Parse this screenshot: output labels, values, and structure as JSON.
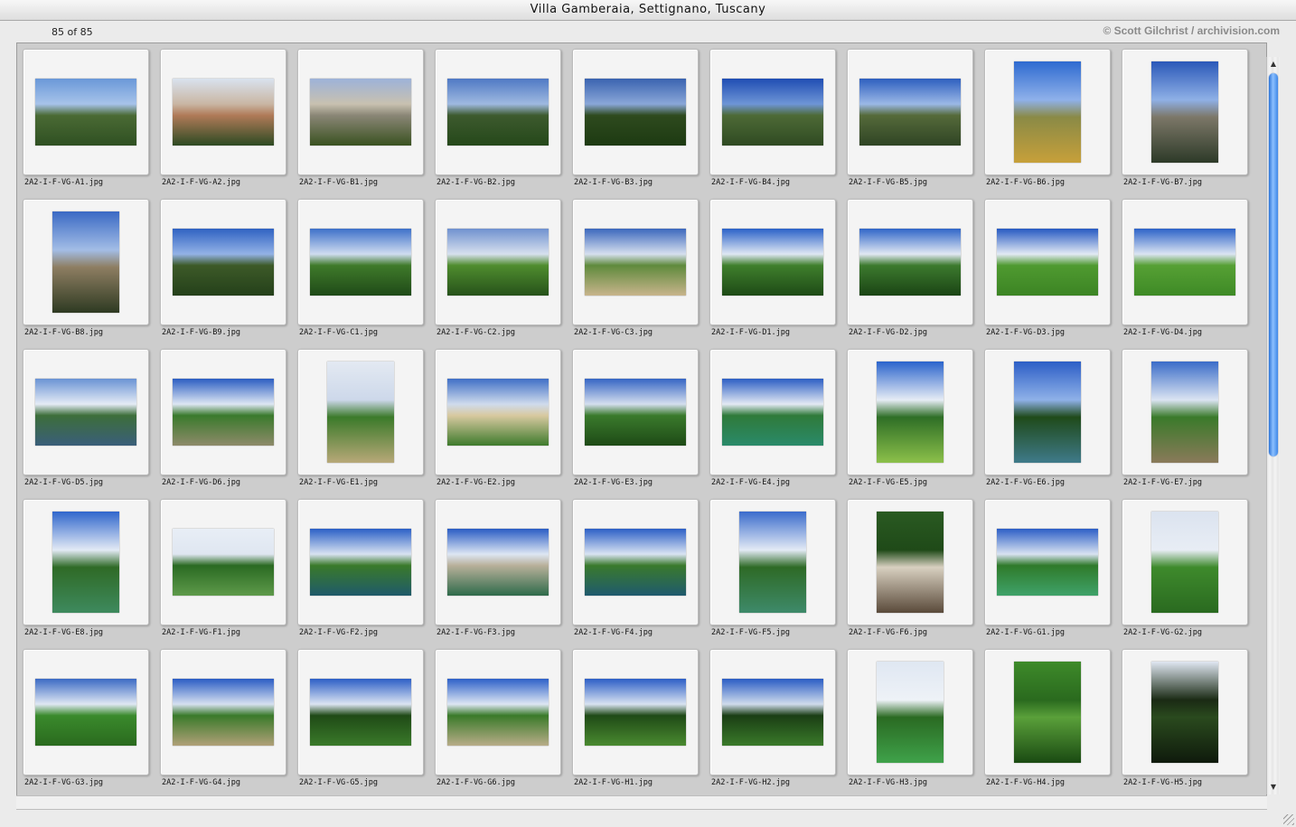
{
  "window": {
    "title": "Villa Gamberaia, Settignano, Tuscany"
  },
  "header": {
    "count": "85 of 85",
    "credit": "© Scott Gilchrist / archivision.com"
  },
  "scrollbar": {
    "up_arrow": "▲",
    "down_arrow": "▼",
    "position": 0
  },
  "thumbnails": [
    {
      "name": "2A2-I-F-VG-A1.jpg",
      "orientation": "landscape",
      "colors": [
        "#6a98d8",
        "#a7c3ea",
        "#4a6a34",
        "#2f5022"
      ]
    },
    {
      "name": "2A2-I-F-VG-A2.jpg",
      "orientation": "landscape",
      "colors": [
        "#d9e2ee",
        "#c9b6a3",
        "#b07a58",
        "#2d4a22"
      ]
    },
    {
      "name": "2A2-I-F-VG-B1.jpg",
      "orientation": "landscape",
      "colors": [
        "#9db2d9",
        "#c8c1b0",
        "#8a8676",
        "#3a5220"
      ]
    },
    {
      "name": "2A2-I-F-VG-B2.jpg",
      "orientation": "landscape",
      "colors": [
        "#4f79c4",
        "#9fb9e0",
        "#3d5a2e",
        "#25481a"
      ]
    },
    {
      "name": "2A2-I-F-VG-B3.jpg",
      "orientation": "landscape",
      "colors": [
        "#3a63b0",
        "#8aa7d8",
        "#2e4a1e",
        "#1d3a12"
      ]
    },
    {
      "name": "2A2-I-F-VG-B4.jpg",
      "orientation": "landscape",
      "colors": [
        "#1f4db3",
        "#6e95d6",
        "#4d6a36",
        "#2f4a22"
      ]
    },
    {
      "name": "2A2-I-F-VG-B5.jpg",
      "orientation": "landscape",
      "colors": [
        "#2d5fbf",
        "#9bb8e6",
        "#556a3a",
        "#2f4424"
      ]
    },
    {
      "name": "2A2-I-F-VG-B6.jpg",
      "orientation": "portrait",
      "colors": [
        "#2e6ad0",
        "#8fb1ea",
        "#8a8a46",
        "#c7a03a"
      ]
    },
    {
      "name": "2A2-I-F-VG-B7.jpg",
      "orientation": "portrait",
      "colors": [
        "#2a58b8",
        "#8fb0e6",
        "#7c7768",
        "#2d3a28"
      ]
    },
    {
      "name": "2A2-I-F-VG-B8.jpg",
      "orientation": "portrait",
      "colors": [
        "#3a69c4",
        "#a3bde6",
        "#8e7e62",
        "#2e3a22"
      ]
    },
    {
      "name": "2A2-I-F-VG-B9.jpg",
      "orientation": "landscape",
      "colors": [
        "#2f62c2",
        "#93b2e6",
        "#3d5a28",
        "#24401a"
      ]
    },
    {
      "name": "2A2-I-F-VG-C1.jpg",
      "orientation": "landscape",
      "colors": [
        "#3d70c9",
        "#cfdcf0",
        "#3f7a2a",
        "#1f4a18"
      ]
    },
    {
      "name": "2A2-I-F-VG-C2.jpg",
      "orientation": "landscape",
      "colors": [
        "#6f91cf",
        "#d7e0ee",
        "#4f8c2e",
        "#26521a"
      ]
    },
    {
      "name": "2A2-I-F-VG-C3.jpg",
      "orientation": "landscape",
      "colors": [
        "#3b67bd",
        "#d6dfee",
        "#5f8a3c",
        "#c8b48c"
      ]
    },
    {
      "name": "2A2-I-F-VG-D1.jpg",
      "orientation": "landscape",
      "colors": [
        "#2a61c8",
        "#dfe7f3",
        "#3f7f2c",
        "#1e4a16"
      ]
    },
    {
      "name": "2A2-I-F-VG-D2.jpg",
      "orientation": "landscape",
      "colors": [
        "#2f65c8",
        "#e1e8f3",
        "#3c7a2e",
        "#1a4414"
      ]
    },
    {
      "name": "2A2-I-F-VG-D3.jpg",
      "orientation": "landscape",
      "colors": [
        "#2659c2",
        "#e2e9f4",
        "#4f9a30",
        "#3c8424"
      ]
    },
    {
      "name": "2A2-I-F-VG-D4.jpg",
      "orientation": "landscape",
      "colors": [
        "#2c62c8",
        "#dbe4f2",
        "#56a034",
        "#3e8a26"
      ]
    },
    {
      "name": "2A2-I-F-VG-D5.jpg",
      "orientation": "landscape",
      "colors": [
        "#6a93d4",
        "#e4ebf5",
        "#3d6e3a",
        "#3a5e7a"
      ]
    },
    {
      "name": "2A2-I-F-VG-D6.jpg",
      "orientation": "landscape",
      "colors": [
        "#2b5dc2",
        "#dde6f3",
        "#3a7a2c",
        "#8e8a6a"
      ]
    },
    {
      "name": "2A2-I-F-VG-E1.jpg",
      "orientation": "portrait",
      "colors": [
        "#e3e9f2",
        "#cdd8ea",
        "#3b7a2a",
        "#b8a878"
      ]
    },
    {
      "name": "2A2-I-F-VG-E2.jpg",
      "orientation": "landscape",
      "colors": [
        "#3f6fc6",
        "#cfdbec",
        "#d8c9a0",
        "#3e7a2c"
      ]
    },
    {
      "name": "2A2-I-F-VG-E3.jpg",
      "orientation": "landscape",
      "colors": [
        "#3565c4",
        "#d4deee",
        "#3a7a2c",
        "#1e4a16"
      ]
    },
    {
      "name": "2A2-I-F-VG-E4.jpg",
      "orientation": "landscape",
      "colors": [
        "#2c5ec4",
        "#e3e9f3",
        "#2f7a3a",
        "#2a8a6a"
      ]
    },
    {
      "name": "2A2-I-F-VG-E5.jpg",
      "orientation": "portrait",
      "colors": [
        "#2a64cc",
        "#e6ecf5",
        "#2e6e26",
        "#8cc04a"
      ]
    },
    {
      "name": "2A2-I-F-VG-E6.jpg",
      "orientation": "portrait",
      "colors": [
        "#2c5ec6",
        "#8fb1e8",
        "#1f4a1a",
        "#3f7a8a"
      ]
    },
    {
      "name": "2A2-I-F-VG-E7.jpg",
      "orientation": "portrait",
      "colors": [
        "#3a6cc8",
        "#dbe4f2",
        "#3a7a2a",
        "#8a7a5a"
      ]
    },
    {
      "name": "2A2-I-F-VG-E8.jpg",
      "orientation": "portrait",
      "colors": [
        "#2f66cc",
        "#e3eaf5",
        "#2f6a26",
        "#3e8a5e"
      ]
    },
    {
      "name": "2A2-I-F-VG-F1.jpg",
      "orientation": "landscape",
      "colors": [
        "#e8eef6",
        "#dfe6f1",
        "#2a6a22",
        "#5e9a4a"
      ]
    },
    {
      "name": "2A2-I-F-VG-F2.jpg",
      "orientation": "landscape",
      "colors": [
        "#2a5fc6",
        "#d8e2f1",
        "#3a7a2a",
        "#1f5a6a"
      ]
    },
    {
      "name": "2A2-I-F-VG-F3.jpg",
      "orientation": "landscape",
      "colors": [
        "#2a5cc4",
        "#dde6f3",
        "#b8b09a",
        "#2e6a4a"
      ]
    },
    {
      "name": "2A2-I-F-VG-F4.jpg",
      "orientation": "landscape",
      "colors": [
        "#2c5fc6",
        "#d9e3f2",
        "#3a7a2c",
        "#1f5a6e"
      ]
    },
    {
      "name": "2A2-I-F-VG-F5.jpg",
      "orientation": "portrait",
      "colors": [
        "#3a6ccc",
        "#e3eaf5",
        "#2e6a26",
        "#3e8a6a"
      ]
    },
    {
      "name": "2A2-I-F-VG-F6.jpg",
      "orientation": "portrait",
      "colors": [
        "#2a5a22",
        "#1f4a18",
        "#d8d0c0",
        "#5a4a3a"
      ]
    },
    {
      "name": "2A2-I-F-VG-G1.jpg",
      "orientation": "landscape",
      "colors": [
        "#2c5ec6",
        "#d8e2f1",
        "#2f7a2a",
        "#3fa26a"
      ]
    },
    {
      "name": "2A2-I-F-VG-G2.jpg",
      "orientation": "portrait",
      "colors": [
        "#dbe3ef",
        "#e8edf5",
        "#3e8a2c",
        "#2a6a20"
      ]
    },
    {
      "name": "2A2-I-F-VG-G3.jpg",
      "orientation": "landscape",
      "colors": [
        "#3b6ac4",
        "#dfe7f3",
        "#3a8a2c",
        "#2a6a1e"
      ]
    },
    {
      "name": "2A2-I-F-VG-G4.jpg",
      "orientation": "landscape",
      "colors": [
        "#2a5cc4",
        "#d6e0f0",
        "#3a7a2a",
        "#b0a078"
      ]
    },
    {
      "name": "2A2-I-F-VG-G5.jpg",
      "orientation": "landscape",
      "colors": [
        "#2c5ec6",
        "#dbe4f2",
        "#1f4a16",
        "#3a7a2a"
      ]
    },
    {
      "name": "2A2-I-F-VG-G6.jpg",
      "orientation": "landscape",
      "colors": [
        "#2d60c8",
        "#dde6f3",
        "#3a7a2a",
        "#b8ac88"
      ]
    },
    {
      "name": "2A2-I-F-VG-H1.jpg",
      "orientation": "landscape",
      "colors": [
        "#2c5ec6",
        "#d8e2f1",
        "#1f4a16",
        "#4a8a30"
      ]
    },
    {
      "name": "2A2-I-F-VG-H2.jpg",
      "orientation": "landscape",
      "colors": [
        "#2a5cc4",
        "#cfdbec",
        "#1a3e14",
        "#3a7a2a"
      ]
    },
    {
      "name": "2A2-I-F-VG-H3.jpg",
      "orientation": "portrait",
      "colors": [
        "#dfe7f2",
        "#eef2f7",
        "#2a6a22",
        "#3fa24a"
      ]
    },
    {
      "name": "2A2-I-F-VG-H4.jpg",
      "orientation": "portrait",
      "colors": [
        "#3e8a2a",
        "#2a6a1e",
        "#5aa03a",
        "#1a4a12"
      ]
    },
    {
      "name": "2A2-I-F-VG-H5.jpg",
      "orientation": "portrait",
      "colors": [
        "#e0e7f2",
        "#1a2a14",
        "#2a4a1e",
        "#0f1a0c"
      ]
    }
  ]
}
